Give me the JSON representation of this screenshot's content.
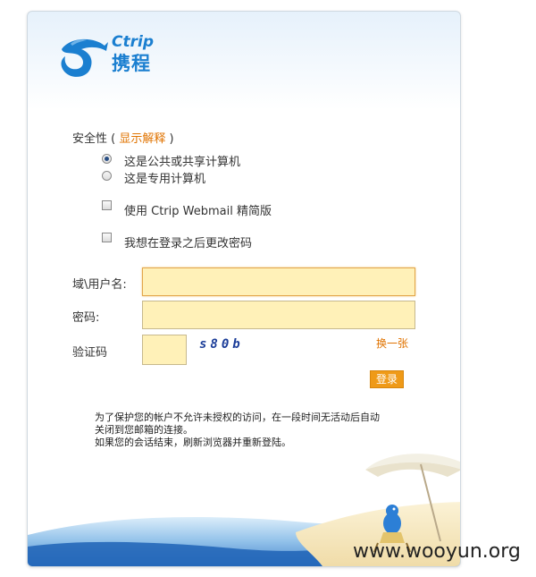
{
  "brand": {
    "name_en": "Ctrip",
    "name_cn": "携程"
  },
  "security": {
    "label": "安全性",
    "paren_open": "(",
    "paren_close": ")",
    "explain_link": "显示解释",
    "options": [
      {
        "label": "这是公共或共享计算机",
        "checked": true
      },
      {
        "label": "这是专用计算机",
        "checked": false
      }
    ]
  },
  "checkboxes": {
    "light": {
      "label": "使用 Ctrip Webmail 精简版",
      "checked": false
    },
    "change_pw": {
      "label": "我想在登录之后更改密码",
      "checked": false
    }
  },
  "form": {
    "username_label": "域\\用户名:",
    "username_value": "",
    "password_label": "密码:",
    "password_value": "",
    "captcha_label": "验证码",
    "captcha_value": "",
    "captcha_text": "s80b",
    "refresh_link": "换一张",
    "login_button": "登录"
  },
  "notice": {
    "line1": "为了保护您的帐户不允许未授权的访问，在一段时间无活动后自动",
    "line2": "关闭到您邮箱的连接。",
    "line3": "如果您的会话结束，刷新浏览器并重新登陆。"
  },
  "watermark": "www.wooyun.org",
  "colors": {
    "accent": "#e07300",
    "field_bg": "#fff1b8",
    "button": "#ef9a18",
    "brand": "#1b7fd0"
  }
}
